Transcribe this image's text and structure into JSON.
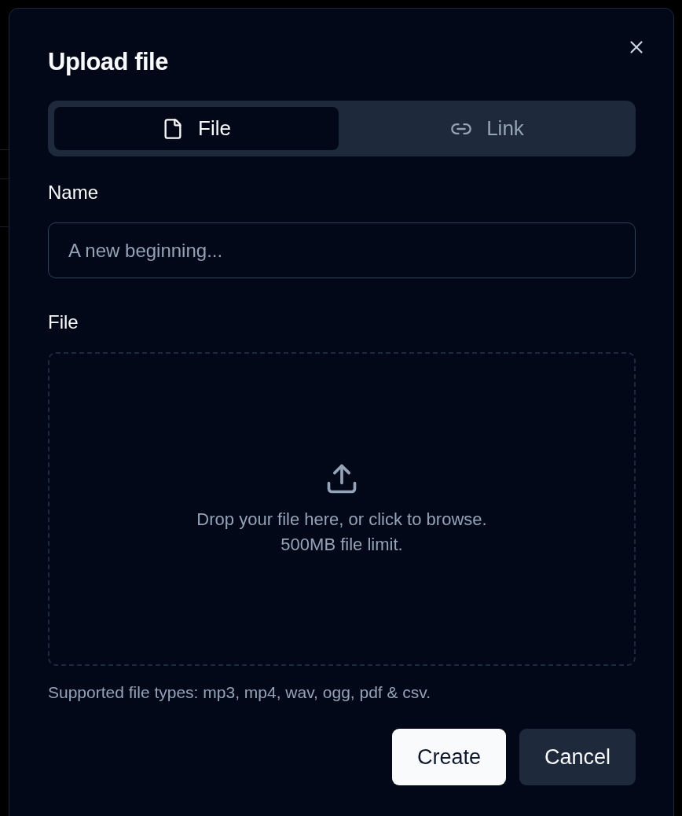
{
  "dialog": {
    "title": "Upload file",
    "tabs": [
      {
        "label": "File",
        "kind": "file",
        "selected": true
      },
      {
        "label": "Link",
        "kind": "link",
        "selected": false
      }
    ],
    "name_field": {
      "label": "Name",
      "placeholder": "A new beginning..."
    },
    "file_field": {
      "label": "File",
      "drop_text": "Drop your file here, or click to browse.",
      "limit": "500MB file limit.",
      "help": "Supported file types: mp3, mp4, wav, ogg, pdf & csv."
    },
    "buttons": [
      {
        "label": "Create",
        "kind": "primary"
      },
      {
        "label": "Cancel",
        "kind": "secondary"
      }
    ]
  }
}
